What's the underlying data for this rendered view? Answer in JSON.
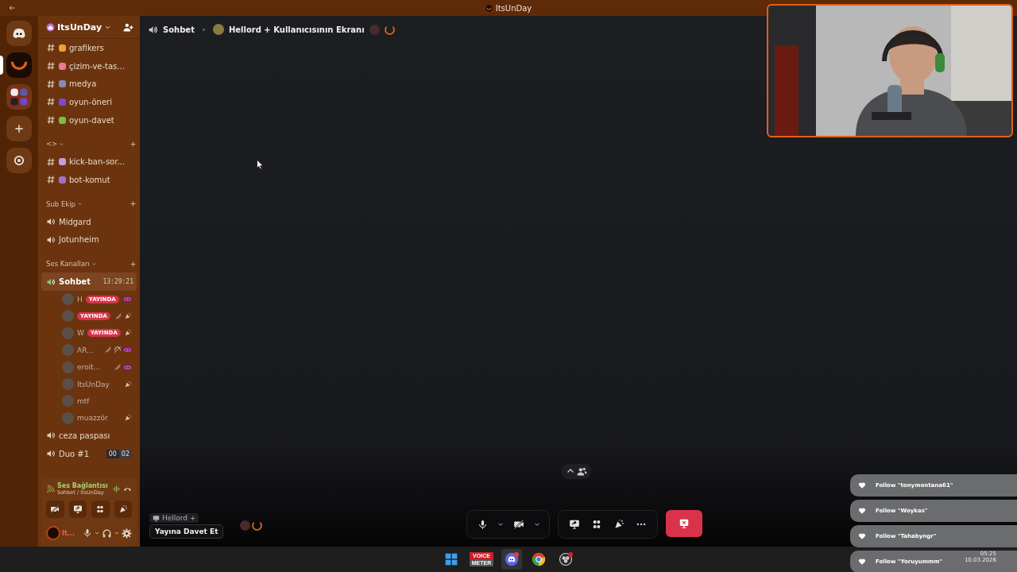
{
  "window": {
    "title": "ItsUnDay"
  },
  "servers": [
    {
      "kind": "home",
      "selected": false
    },
    {
      "kind": "server",
      "selected": true
    },
    {
      "kind": "folder",
      "selected": false
    },
    {
      "kind": "add",
      "selected": false
    },
    {
      "kind": "discover",
      "selected": false
    }
  ],
  "server_header": {
    "name": "ItsUnDay"
  },
  "sections": [
    {
      "channels": [
        {
          "kind": "text",
          "name": "grafikers",
          "color": "#f0a030"
        },
        {
          "kind": "text",
          "name": "çizim-ve-tas...",
          "color": "#e87a9a"
        },
        {
          "kind": "text",
          "name": "medya",
          "color": "#8a8ab8"
        },
        {
          "kind": "text",
          "name": "oyun-öneri",
          "color": "#7a4ad8"
        },
        {
          "kind": "text",
          "name": "oyun-davet",
          "color": "#7ac040"
        }
      ]
    },
    {
      "title": "<>",
      "channels": [
        {
          "kind": "text",
          "name": "kick-ban-sor...",
          "color": "#c0a0e0"
        },
        {
          "kind": "text",
          "name": "bot-komut",
          "color": "#a070d0"
        }
      ]
    },
    {
      "title": "Sub Ekip",
      "channels": [
        {
          "kind": "voice",
          "name": "Midgard"
        },
        {
          "kind": "voice",
          "name": "Jotunheim"
        }
      ]
    },
    {
      "title": "Ses Kanalları",
      "channels": [
        {
          "kind": "voice",
          "name": "Sohbet",
          "selected": true,
          "timer": "13:29:21",
          "members": [
            {
              "name": "H",
              "badge": "YAYINDA",
              "indicators": [
                {
                  "kind": "activity"
                }
              ]
            },
            {
              "badge": "YAYINDA",
              "indicators": [
                {
                  "kind": "muted"
                },
                {
                  "kind": "game"
                }
              ]
            },
            {
              "name": "W",
              "badge": "YAYINDA",
              "indicators": [
                {
                  "kind": "game"
                }
              ]
            },
            {
              "name": "AR...",
              "indicators": [
                {
                  "kind": "muted"
                },
                {
                  "kind": "deafened"
                },
                {
                  "kind": "activity"
                }
              ]
            },
            {
              "name": "eroit...",
              "indicators": [
                {
                  "kind": "muted"
                },
                {
                  "kind": "activity"
                }
              ]
            },
            {
              "name": "ItsUnDay",
              "indicators": [
                {
                  "kind": "game"
                }
              ]
            },
            {
              "name": "mtf"
            },
            {
              "name": "muazzör",
              "indicators": [
                {
                  "kind": "game"
                }
              ]
            }
          ]
        },
        {
          "kind": "voice",
          "name": "ceza paspası"
        },
        {
          "kind": "voice",
          "name": "Duo #1",
          "counters": [
            "00",
            "02"
          ]
        }
      ]
    }
  ],
  "voice_panel": {
    "status": "Ses Bağlantısı",
    "location": "Sohbet / ItsUnDay"
  },
  "user_panel": {
    "name": "It..."
  },
  "header": {
    "channel": "Sohbet",
    "stream": "Hellord + Kullanıcısının Ekranı"
  },
  "stage": {
    "stream_label": "Hellord +",
    "tooltip": "Yayına Davet Et"
  },
  "notifications": [
    {
      "text": "Follow \"tonymontana61\""
    },
    {
      "text": "Follow \"Woykas\""
    },
    {
      "text": "Follow \"Tahabyngr\""
    },
    {
      "text": "Follow \"Yoruyummm\""
    }
  ],
  "taskbar": {
    "apps": [
      {
        "kind": "start"
      },
      {
        "kind": "voicemeeter",
        "lines": [
          "VOICE",
          "METER"
        ]
      },
      {
        "kind": "discord",
        "selected": true
      },
      {
        "kind": "chrome",
        "selected": false
      },
      {
        "kind": "obs",
        "selected": false
      }
    ],
    "time": "05:25",
    "date": "10.03.2026"
  }
}
